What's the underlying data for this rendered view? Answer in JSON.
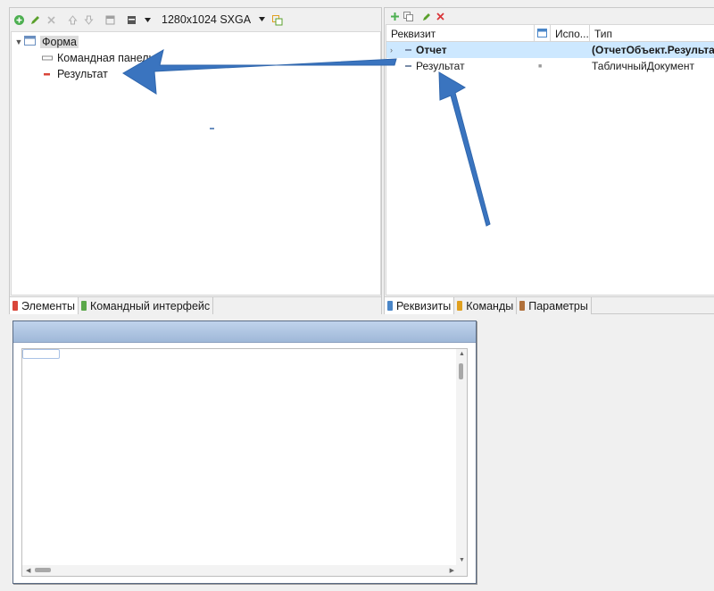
{
  "left_panel": {
    "toolbar": {
      "resolution": "1280x1024 SXGA"
    },
    "tree": {
      "root": "Форма",
      "children": [
        {
          "label": "Командная панель",
          "icon": "command-bar-icon"
        },
        {
          "label": "Результат",
          "icon": "field-icon"
        }
      ]
    },
    "tabs": [
      {
        "label": "Элементы",
        "color": "#d9463a",
        "active": true
      },
      {
        "label": "Командный интерфейс",
        "color": "#5ba84a",
        "active": false
      }
    ]
  },
  "right_panel": {
    "columns": [
      "Реквизит",
      "Испо...",
      "Тип"
    ],
    "rows": [
      {
        "name": "Отчет",
        "use": "",
        "type": "(ОтчетОбъект.Результат",
        "selected": true,
        "expandable": true
      },
      {
        "name": "Результат",
        "use": "■",
        "type": "ТабличныйДокумент",
        "selected": false,
        "expandable": false
      }
    ],
    "tabs": [
      {
        "label": "Реквизиты",
        "color": "#4a86c8",
        "active": true
      },
      {
        "label": "Команды",
        "color": "#e0a020",
        "active": false
      },
      {
        "label": "Параметры",
        "color": "#b0703a",
        "active": false
      }
    ]
  },
  "colors": {
    "selection": "#cde8ff",
    "annotation_arrow": "#3a74bf"
  }
}
